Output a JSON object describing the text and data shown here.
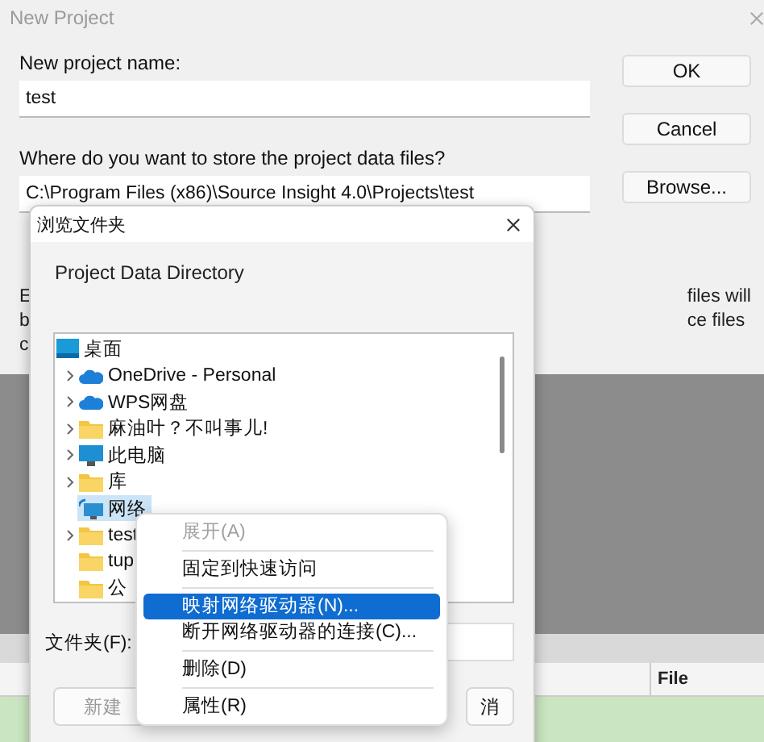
{
  "new_project": {
    "title": "New Project",
    "name_label": "New project name:",
    "name_value": "test",
    "location_label": "Where do you want to store the project data files?",
    "location_value": "C:\\Program Files (x86)\\Source Insight 4.0\\Projects\\test",
    "buttons": [
      "OK",
      "Cancel",
      "Browse..."
    ],
    "partial_text_left": [
      "E",
      "b",
      "c"
    ],
    "partial_text_right": [
      "files will",
      "ce files"
    ]
  },
  "table": {
    "column_2": "File"
  },
  "browse_dialog": {
    "title": "浏览文件夹",
    "description": "Project Data Directory",
    "tree": [
      {
        "label": "桌面",
        "kind": "desktop",
        "selected": false,
        "children": [
          {
            "label": "OneDrive - Personal",
            "kind": "cloud",
            "selected": false,
            "expandable": true
          },
          {
            "label": "WPS网盘",
            "kind": "cloud",
            "selected": false,
            "expandable": true
          },
          {
            "label": "麻油叶？不叫事儿!",
            "kind": "folder",
            "selected": false,
            "expandable": true
          },
          {
            "label": "此电脑",
            "kind": "computer",
            "selected": false,
            "expandable": true
          },
          {
            "label": "库",
            "kind": "folder",
            "selected": false,
            "expandable": true
          },
          {
            "label": "网络",
            "kind": "network",
            "selected": true,
            "expandable": false
          },
          {
            "label": "test",
            "kind": "folder",
            "selected": false,
            "expandable": true
          },
          {
            "label": "tup",
            "kind": "folder",
            "selected": false,
            "expandable": false
          },
          {
            "label": "公",
            "kind": "folder",
            "selected": false,
            "expandable": false
          }
        ]
      }
    ],
    "folder_label": "文件夹(F):",
    "buttons": [
      "新建",
      "消"
    ]
  },
  "context_menu": {
    "items": [
      {
        "label": "展开(A)",
        "disabled": true,
        "selected": false,
        "separator_after": true
      },
      {
        "label": "固定到快速访问",
        "disabled": false,
        "selected": false,
        "separator_after": true
      },
      {
        "label": "映射网络驱动器(N)...",
        "disabled": false,
        "selected": true,
        "separator_after": false
      },
      {
        "label": "断开网络驱动器的连接(C)...",
        "disabled": false,
        "selected": false,
        "separator_after": true
      },
      {
        "label": "删除(D)",
        "disabled": false,
        "selected": false,
        "separator_after": true
      },
      {
        "label": "属性(R)",
        "disabled": false,
        "selected": false,
        "separator_after": false
      }
    ]
  }
}
